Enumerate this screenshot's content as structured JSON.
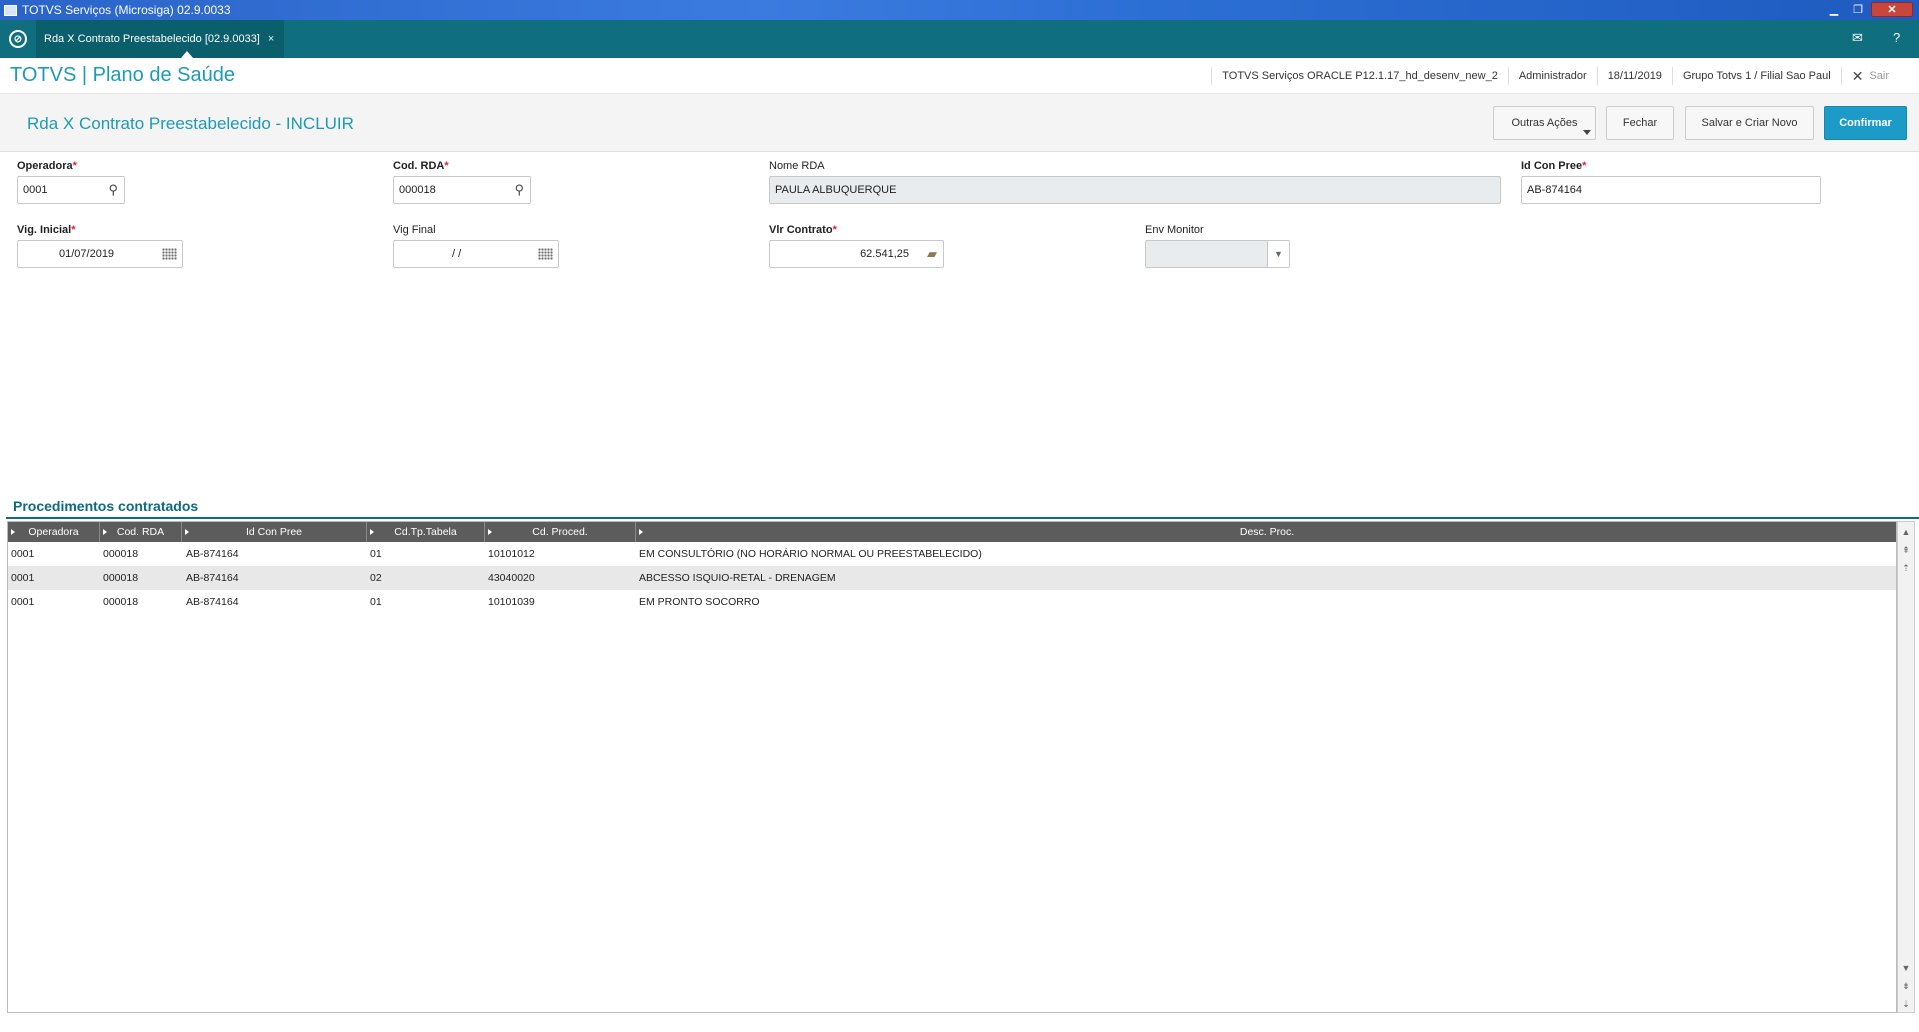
{
  "window": {
    "title": "TOTVS Serviços (Microsiga) 02.9.0033"
  },
  "tabbar": {
    "tab_label": "Rda X Contrato Preestabelecido [02.9.0033]"
  },
  "header": {
    "brand": "TOTVS | Plano de Saúde",
    "environment": "TOTVS Serviços ORACLE P12.1.17_hd_desenv_new_2",
    "user": "Administrador",
    "date": "18/11/2019",
    "branch": "Grupo Totvs 1 / Filial Sao Paul",
    "exit_label": "Sair"
  },
  "toolbar": {
    "title": "Rda X Contrato Preestabelecido - INCLUIR",
    "other_actions": "Outras Ações",
    "close": "Fechar",
    "save_new": "Salvar e Criar Novo",
    "confirm": "Confirmar"
  },
  "form": {
    "operadora": {
      "label": "Operadora",
      "value": "0001"
    },
    "cod_rda": {
      "label": "Cod. RDA",
      "value": "000018"
    },
    "nome_rda": {
      "label": "Nome RDA",
      "value": "PAULA ALBUQUERQUE"
    },
    "id_con_pree": {
      "label": "Id Con Pree",
      "value": "AB-874164"
    },
    "vig_inicial": {
      "label": "Vig. Inicial",
      "value": "01/07/2019"
    },
    "vig_final": {
      "label": "Vig Final",
      "value": "/ /"
    },
    "vlr_contrato": {
      "label": "Vlr Contrato",
      "value": "62.541,25"
    },
    "env_monitor": {
      "label": "Env Monitor",
      "value": ""
    }
  },
  "grid": {
    "title": "Procedimentos contratados",
    "columns": [
      "Operadora",
      "Cod. RDA",
      "Id Con Pree",
      "Cd.Tp.Tabela",
      "Cd. Proced.",
      "Desc. Proc."
    ],
    "rows": [
      [
        "0001",
        "000018",
        "AB-874164",
        "01",
        "10101012",
        "EM CONSULTÓRIO (NO HORÁRIO NORMAL OU PREESTABELECIDO)"
      ],
      [
        "0001",
        "000018",
        "AB-874164",
        "02",
        "43040020",
        "ABCESSO ISQUIO-RETAL - DRENAGEM"
      ],
      [
        "0001",
        "000018",
        "AB-874164",
        "01",
        "10101039",
        "EM PRONTO SOCORRO"
      ]
    ]
  },
  "colors": {
    "accent": "#1d9bb5",
    "tabbar": "#0f6f7e",
    "primary_button": "#1d9bc8",
    "grid_header": "#5c5c5c"
  }
}
